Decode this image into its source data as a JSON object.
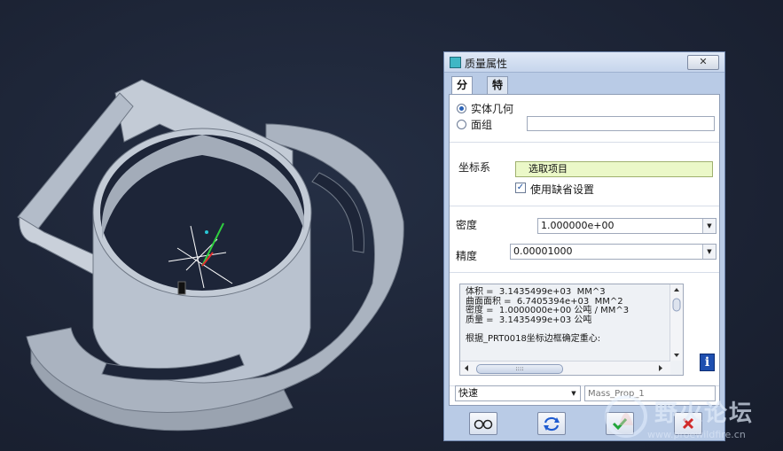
{
  "dialog": {
    "title": "质量属性",
    "close_label": "✕",
    "tabs": [
      {
        "label": "分析"
      },
      {
        "label": "特征"
      }
    ],
    "geometry_options": {
      "solid_label": "实体几何",
      "quilt_label": "面组",
      "quilt_value": ""
    },
    "coord_system": {
      "label": "坐标系",
      "select_value": "选取项目",
      "use_default_label": "使用缺省设置",
      "use_default_checked": true
    },
    "density": {
      "label": "密度",
      "value": "1.000000e+00"
    },
    "accuracy": {
      "label": "精度",
      "value": "0.00001000"
    },
    "results": {
      "lines": [
        "体积 =  3.1435499e+03  MM^3",
        "曲面面积 =  6.7405394e+03  MM^2",
        "密度 =  1.0000000e+00 公吨 / MM^3",
        "质量 =  3.1435499e+03 公吨",
        "",
        "根据_PRT0018坐标边框确定重心:"
      ]
    },
    "mode": {
      "value": "快速",
      "name_placeholder": "Mass_Prop_1"
    }
  },
  "watermark": {
    "title": "野火论坛",
    "url": "www.proewildfire.cn"
  },
  "colors": {
    "background": "#1d2538",
    "part": "#b9c2cf",
    "dialog": "#b9cbe6",
    "highlight": "#ebf8c8"
  }
}
